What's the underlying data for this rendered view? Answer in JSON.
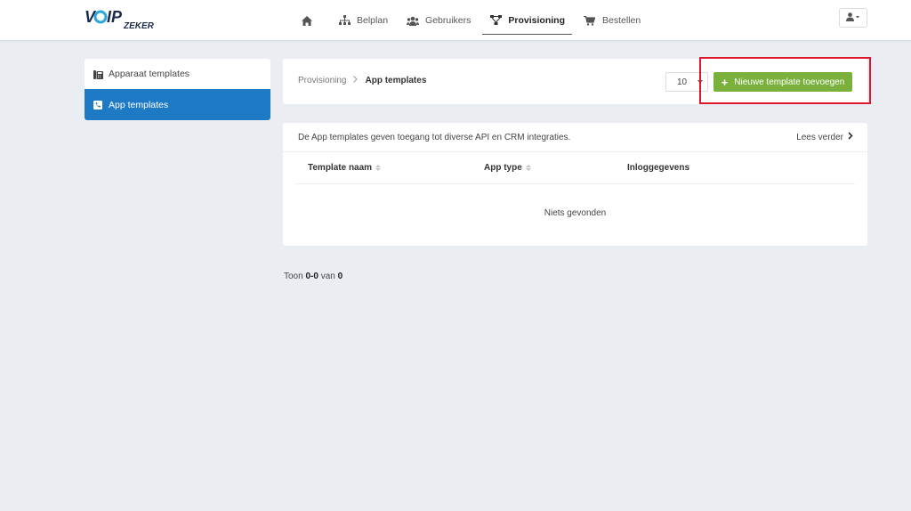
{
  "brand": {
    "logo_main": "VOIP",
    "logo_sub": "ZEKER",
    "colors": {
      "dark": "#1c2b4a",
      "blue": "#2aa7df"
    }
  },
  "nav": {
    "items": [
      {
        "label": "",
        "icon": "home-icon"
      },
      {
        "label": "Belplan",
        "icon": "sitemap-icon"
      },
      {
        "label": "Gebruikers",
        "icon": "users-icon"
      },
      {
        "label": "Provisioning",
        "icon": "network-icon",
        "active": true
      },
      {
        "label": "Bestellen",
        "icon": "cart-icon"
      }
    ],
    "user_menu_icon": "user-icon"
  },
  "sidebar": {
    "items": [
      {
        "label": "Apparaat templates",
        "icon": "phone-device-icon",
        "active": false
      },
      {
        "label": "App templates",
        "icon": "phone-square-icon",
        "active": true
      }
    ]
  },
  "header": {
    "breadcrumb": [
      "Provisioning",
      "App templates"
    ],
    "per_page": "10",
    "add_button_label": "Nieuwe template toevoegen",
    "accent": "#7ab03c"
  },
  "table": {
    "info_text": "De App templates geven toegang tot diverse API en CRM integraties.",
    "read_more": "Lees verder",
    "columns": [
      "Template naam",
      "App type",
      "Inloggegevens"
    ],
    "empty_text": "Niets gevonden"
  },
  "footer": {
    "prefix": "Toon",
    "range": "0-0",
    "of": "van",
    "total": "0"
  }
}
